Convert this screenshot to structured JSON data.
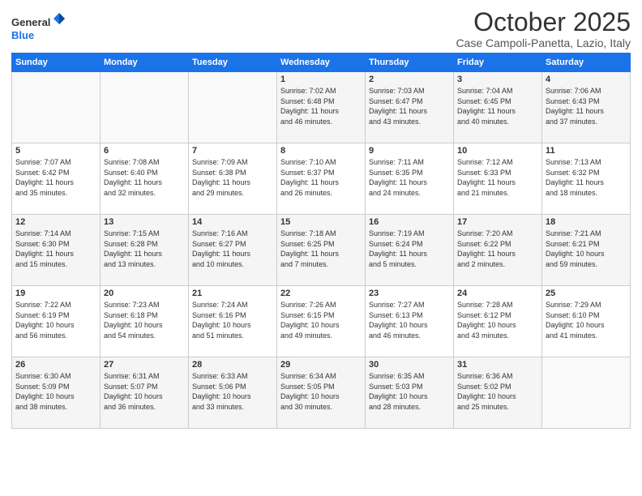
{
  "header": {
    "logo_general": "General",
    "logo_blue": "Blue",
    "month_title": "October 2025",
    "location": "Case Campoli-Panetta, Lazio, Italy"
  },
  "weekdays": [
    "Sunday",
    "Monday",
    "Tuesday",
    "Wednesday",
    "Thursday",
    "Friday",
    "Saturday"
  ],
  "weeks": [
    [
      {
        "day": "",
        "info": ""
      },
      {
        "day": "",
        "info": ""
      },
      {
        "day": "",
        "info": ""
      },
      {
        "day": "1",
        "info": "Sunrise: 7:02 AM\nSunset: 6:48 PM\nDaylight: 11 hours\nand 46 minutes."
      },
      {
        "day": "2",
        "info": "Sunrise: 7:03 AM\nSunset: 6:47 PM\nDaylight: 11 hours\nand 43 minutes."
      },
      {
        "day": "3",
        "info": "Sunrise: 7:04 AM\nSunset: 6:45 PM\nDaylight: 11 hours\nand 40 minutes."
      },
      {
        "day": "4",
        "info": "Sunrise: 7:06 AM\nSunset: 6:43 PM\nDaylight: 11 hours\nand 37 minutes."
      }
    ],
    [
      {
        "day": "5",
        "info": "Sunrise: 7:07 AM\nSunset: 6:42 PM\nDaylight: 11 hours\nand 35 minutes."
      },
      {
        "day": "6",
        "info": "Sunrise: 7:08 AM\nSunset: 6:40 PM\nDaylight: 11 hours\nand 32 minutes."
      },
      {
        "day": "7",
        "info": "Sunrise: 7:09 AM\nSunset: 6:38 PM\nDaylight: 11 hours\nand 29 minutes."
      },
      {
        "day": "8",
        "info": "Sunrise: 7:10 AM\nSunset: 6:37 PM\nDaylight: 11 hours\nand 26 minutes."
      },
      {
        "day": "9",
        "info": "Sunrise: 7:11 AM\nSunset: 6:35 PM\nDaylight: 11 hours\nand 24 minutes."
      },
      {
        "day": "10",
        "info": "Sunrise: 7:12 AM\nSunset: 6:33 PM\nDaylight: 11 hours\nand 21 minutes."
      },
      {
        "day": "11",
        "info": "Sunrise: 7:13 AM\nSunset: 6:32 PM\nDaylight: 11 hours\nand 18 minutes."
      }
    ],
    [
      {
        "day": "12",
        "info": "Sunrise: 7:14 AM\nSunset: 6:30 PM\nDaylight: 11 hours\nand 15 minutes."
      },
      {
        "day": "13",
        "info": "Sunrise: 7:15 AM\nSunset: 6:28 PM\nDaylight: 11 hours\nand 13 minutes."
      },
      {
        "day": "14",
        "info": "Sunrise: 7:16 AM\nSunset: 6:27 PM\nDaylight: 11 hours\nand 10 minutes."
      },
      {
        "day": "15",
        "info": "Sunrise: 7:18 AM\nSunset: 6:25 PM\nDaylight: 11 hours\nand 7 minutes."
      },
      {
        "day": "16",
        "info": "Sunrise: 7:19 AM\nSunset: 6:24 PM\nDaylight: 11 hours\nand 5 minutes."
      },
      {
        "day": "17",
        "info": "Sunrise: 7:20 AM\nSunset: 6:22 PM\nDaylight: 11 hours\nand 2 minutes."
      },
      {
        "day": "18",
        "info": "Sunrise: 7:21 AM\nSunset: 6:21 PM\nDaylight: 10 hours\nand 59 minutes."
      }
    ],
    [
      {
        "day": "19",
        "info": "Sunrise: 7:22 AM\nSunset: 6:19 PM\nDaylight: 10 hours\nand 56 minutes."
      },
      {
        "day": "20",
        "info": "Sunrise: 7:23 AM\nSunset: 6:18 PM\nDaylight: 10 hours\nand 54 minutes."
      },
      {
        "day": "21",
        "info": "Sunrise: 7:24 AM\nSunset: 6:16 PM\nDaylight: 10 hours\nand 51 minutes."
      },
      {
        "day": "22",
        "info": "Sunrise: 7:26 AM\nSunset: 6:15 PM\nDaylight: 10 hours\nand 49 minutes."
      },
      {
        "day": "23",
        "info": "Sunrise: 7:27 AM\nSunset: 6:13 PM\nDaylight: 10 hours\nand 46 minutes."
      },
      {
        "day": "24",
        "info": "Sunrise: 7:28 AM\nSunset: 6:12 PM\nDaylight: 10 hours\nand 43 minutes."
      },
      {
        "day": "25",
        "info": "Sunrise: 7:29 AM\nSunset: 6:10 PM\nDaylight: 10 hours\nand 41 minutes."
      }
    ],
    [
      {
        "day": "26",
        "info": "Sunrise: 6:30 AM\nSunset: 5:09 PM\nDaylight: 10 hours\nand 38 minutes."
      },
      {
        "day": "27",
        "info": "Sunrise: 6:31 AM\nSunset: 5:07 PM\nDaylight: 10 hours\nand 36 minutes."
      },
      {
        "day": "28",
        "info": "Sunrise: 6:33 AM\nSunset: 5:06 PM\nDaylight: 10 hours\nand 33 minutes."
      },
      {
        "day": "29",
        "info": "Sunrise: 6:34 AM\nSunset: 5:05 PM\nDaylight: 10 hours\nand 30 minutes."
      },
      {
        "day": "30",
        "info": "Sunrise: 6:35 AM\nSunset: 5:03 PM\nDaylight: 10 hours\nand 28 minutes."
      },
      {
        "day": "31",
        "info": "Sunrise: 6:36 AM\nSunset: 5:02 PM\nDaylight: 10 hours\nand 25 minutes."
      },
      {
        "day": "",
        "info": ""
      }
    ]
  ]
}
